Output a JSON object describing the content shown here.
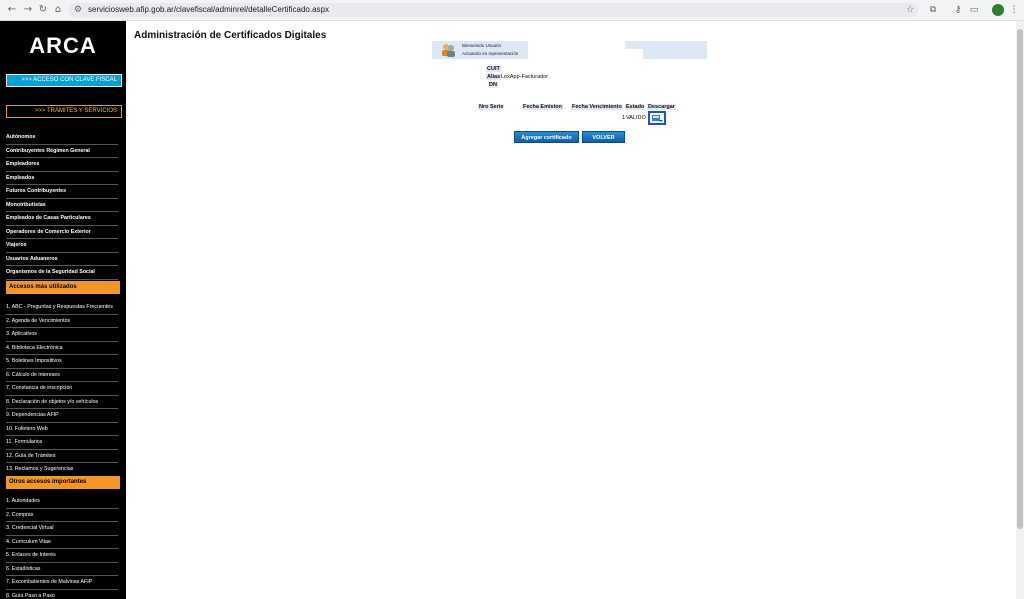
{
  "browser": {
    "url": "serviciosweb.afip.gob.ar/clavefiscal/adminrel/detalleCertificado.aspx",
    "icons": {
      "back": "←",
      "forward": "→",
      "reload": "↻",
      "home": "⌂",
      "site": "⚙",
      "star": "☆",
      "extensions": "⧉",
      "passwords": "⚷",
      "cast": "▭",
      "menu": "⋮"
    }
  },
  "sidebar": {
    "logo": "ARCA",
    "clave_button": ">>> ACCESO CON CLAVE FISCAL",
    "tramites_button": ">>> TRÁMITES Y SERVICIOS",
    "categories": [
      "Autónomos",
      "Contribuyentes Régimen General",
      "Empleadores",
      "Empleados",
      "Futuros Contribuyentes",
      "Monotributistas",
      "Empleados de Casas Particulares",
      "Operadores de Comercio Exterior",
      "Viajeros",
      "Usuarios Aduaneros",
      "Organismos de la Seguridad Social"
    ],
    "mas_utilizados_title": "Accesos más utilizados",
    "mas_utilizados": [
      "1. ABC - Preguntas y Respuestas Frecuentes",
      "2. Agenda de Vencimientos",
      "3. Aplicativos",
      "4. Biblioteca Electrónica",
      "5. Boletines Impositivos",
      "6. Cálculo de intereses",
      "7. Constancia de inscripción",
      "8. Declaración de objetos y/o vehículos",
      "9. Dependencias AFIP",
      "10. Folletero Web",
      "11. Formularios",
      "12. Guía de Trámites",
      "13. Reclamos y Sugerencias"
    ],
    "otros_title": "Otros accesos importantes",
    "otros": [
      "1. Autoridades",
      "2. Compras",
      "3. Credencial Virtual",
      "4. Curriculum Vitae",
      "5. Enlaces de Interés",
      "6. Estadísticas",
      "7. Excombatientes de Malvinas AFIP",
      "8. Guía Paso a Paso"
    ]
  },
  "main": {
    "title": "Administración de Certificados Digitales",
    "user": {
      "welcome": "Bienvenido Usuario",
      "acting": "Actuando en representación"
    },
    "fields": {
      "cuit_label": "CUIT",
      "alias_label": "Alias",
      "alias_value": "LexApp-Facturador",
      "dn_label": "DN"
    },
    "table": {
      "headers": [
        "Nro Serie",
        "Fecha Emision",
        "Fecha Vencimiento",
        "Estado",
        "Descargar"
      ],
      "row": {
        "num": "1",
        "estado": "VALIDO"
      }
    },
    "buttons": {
      "add": "Agregar certificado",
      "back": "VOLVER"
    }
  }
}
